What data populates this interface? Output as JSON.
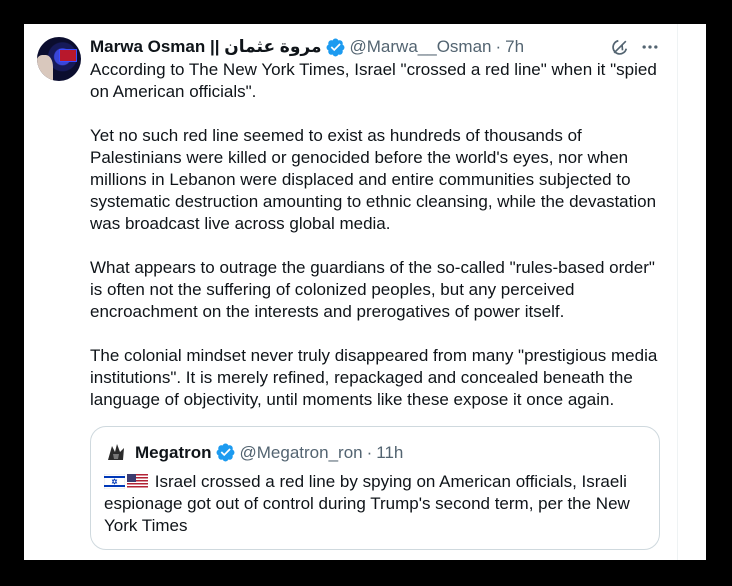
{
  "tweet": {
    "author_name": "Marwa Osman || مروة عثمان",
    "handle": "@Marwa__Osman",
    "separator": "·",
    "time": "7h",
    "paragraphs": [
      "According to The New York Times, Israel \"crossed a red line\" when it \"spied on American officials\".",
      "Yet no such red line seemed to exist as hundreds of thousands of Palestinians were killed or genocided before the world's eyes, nor when millions in Lebanon were displaced and entire communities subjected to systematic destruction amounting to ethnic cleansing, while the devastation was broadcast live across global media.",
      "What appears to outrage the guardians of the so-called \"rules-based order\" is often not the suffering of colonized peoples, but any perceived encroachment on the interests and prerogatives of power itself.",
      "The colonial mindset never truly disappeared from many \"prestigious media institutions\". It is merely refined, repackaged and concealed beneath the language of objectivity, until moments like these expose it once again."
    ]
  },
  "quoted": {
    "author_name": "Megatron",
    "handle": "@Megatron_ron",
    "separator": "·",
    "time": "11h",
    "text": "Israel crossed a red line by spying on American officials, Israeli espionage got out of control during Trump's second term, per the New York Times"
  },
  "icons": {
    "verified": "verified-badge-icon",
    "grok": "grok-icon",
    "more": "more-options-icon"
  },
  "colors": {
    "text": "#0f1419",
    "secondary": "#536471",
    "verified_blue": "#1d9bf0",
    "border": "#cfd9de"
  }
}
